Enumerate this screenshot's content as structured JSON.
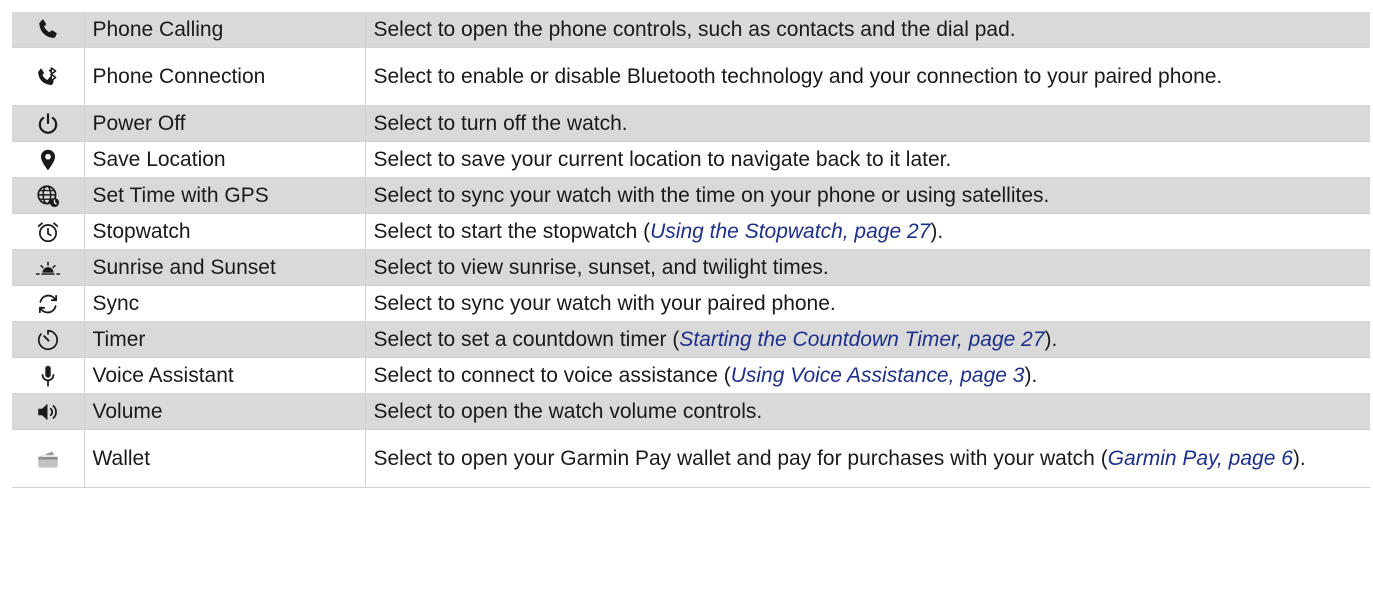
{
  "rows": [
    {
      "icon": "phone-icon",
      "name": "Phone Calling",
      "desc": "Select to open the phone controls, such as contacts and the dial pad.",
      "link": "",
      "after": ""
    },
    {
      "icon": "phone-bluetooth-icon",
      "name": "Phone Connection",
      "desc": "Select to enable or disable Bluetooth technology and your connection to your paired phone.",
      "link": "",
      "after": ""
    },
    {
      "icon": "power-icon",
      "name": "Power Off",
      "desc": "Select to turn off the watch.",
      "link": "",
      "after": ""
    },
    {
      "icon": "location-pin-icon",
      "name": "Save Location",
      "desc": "Select to save your current location to navigate back to it later.",
      "link": "",
      "after": ""
    },
    {
      "icon": "globe-gps-icon",
      "name": "Set Time with GPS",
      "desc": "Select to sync your watch with the time on your phone or using satellites.",
      "link": "",
      "after": ""
    },
    {
      "icon": "stopwatch-icon",
      "name": "Stopwatch",
      "desc": "Select to start the stopwatch (",
      "link": "Using the Stopwatch, page 27",
      "after": ")."
    },
    {
      "icon": "sunrise-icon",
      "name": "Sunrise and Sunset",
      "desc": "Select to view sunrise, sunset, and twilight times.",
      "link": "",
      "after": ""
    },
    {
      "icon": "sync-icon",
      "name": "Sync",
      "desc": "Select to sync your watch with your paired phone.",
      "link": "",
      "after": ""
    },
    {
      "icon": "timer-icon",
      "name": "Timer",
      "desc": "Select to set a countdown timer (",
      "link": "Starting the Countdown Timer, page 27",
      "after": ")."
    },
    {
      "icon": "microphone-icon",
      "name": "Voice Assistant",
      "desc": "Select to connect to voice assistance (",
      "link": "Using Voice Assistance, page 3",
      "after": ")."
    },
    {
      "icon": "volume-icon",
      "name": "Volume",
      "desc": "Select to open the watch volume controls.",
      "link": "",
      "after": ""
    },
    {
      "icon": "wallet-icon",
      "name": "Wallet",
      "desc": "Select to open your Garmin Pay wallet and pay for purchases with your watch (",
      "link": "Garmin Pay, page 6",
      "after": ")."
    }
  ]
}
